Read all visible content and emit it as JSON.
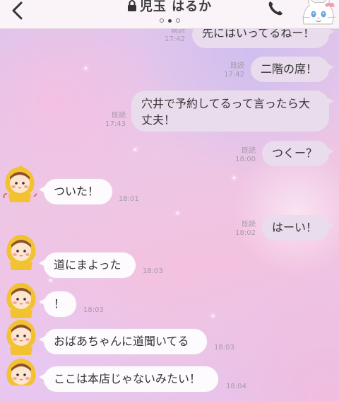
{
  "header": {
    "title": "児玉 はるか",
    "page_dots": 3,
    "active_page_dot": 1
  },
  "messages": [
    {
      "direction": "sent",
      "text": "先にはいってるねー！",
      "read": "既読",
      "time": "17:42"
    },
    {
      "direction": "sent",
      "text": "二階の席！",
      "read": "既読",
      "time": "17:42"
    },
    {
      "direction": "sent",
      "text": "穴井で予約してるって言ったら大丈夫！",
      "read": "既読",
      "time": "17:43"
    },
    {
      "direction": "sent",
      "text": "つくー？",
      "read": "既読",
      "time": "18:00"
    },
    {
      "direction": "received",
      "text": "ついた！",
      "time": "18:01"
    },
    {
      "direction": "sent",
      "text": "はーい！",
      "read": "既読",
      "time": "18:02"
    },
    {
      "direction": "received",
      "text": "道にまよった",
      "time": "18:03"
    },
    {
      "direction": "received",
      "text": "！",
      "time": "18:03"
    },
    {
      "direction": "received",
      "text": "おばあちゃんに道聞いてる",
      "time": "18:03"
    },
    {
      "direction": "received",
      "text": "ここは本店じゃないみたい！",
      "time": "18:04"
    }
  ],
  "colors": {
    "sent_bubble": "#e9dcec",
    "received_bubble": "#fdfbfd",
    "header_bg": "#faf4f8"
  },
  "icons": [
    "back-icon",
    "lock-icon",
    "phone-icon",
    "cat-sticker-icon",
    "avatar-chick"
  ]
}
